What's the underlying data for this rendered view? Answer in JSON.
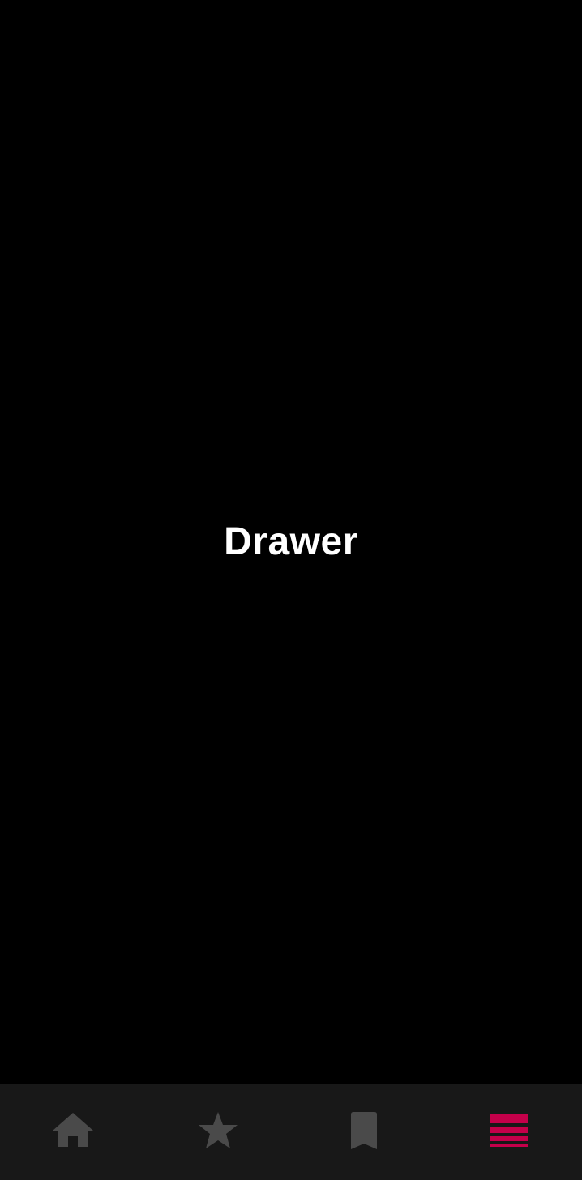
{
  "main": {
    "title": "Drawer"
  },
  "bottom_nav": {
    "items": [
      {
        "icon": "home-icon",
        "active": false
      },
      {
        "icon": "star-icon",
        "active": false
      },
      {
        "icon": "bookmark-icon",
        "active": false
      },
      {
        "icon": "drawer-menu-icon",
        "active": true
      }
    ]
  },
  "colors": {
    "background": "#000000",
    "nav_background": "#181818",
    "inactive_icon": "#4a4a4a",
    "active_accent": "#c4004a",
    "title_text": "#ffffff"
  }
}
